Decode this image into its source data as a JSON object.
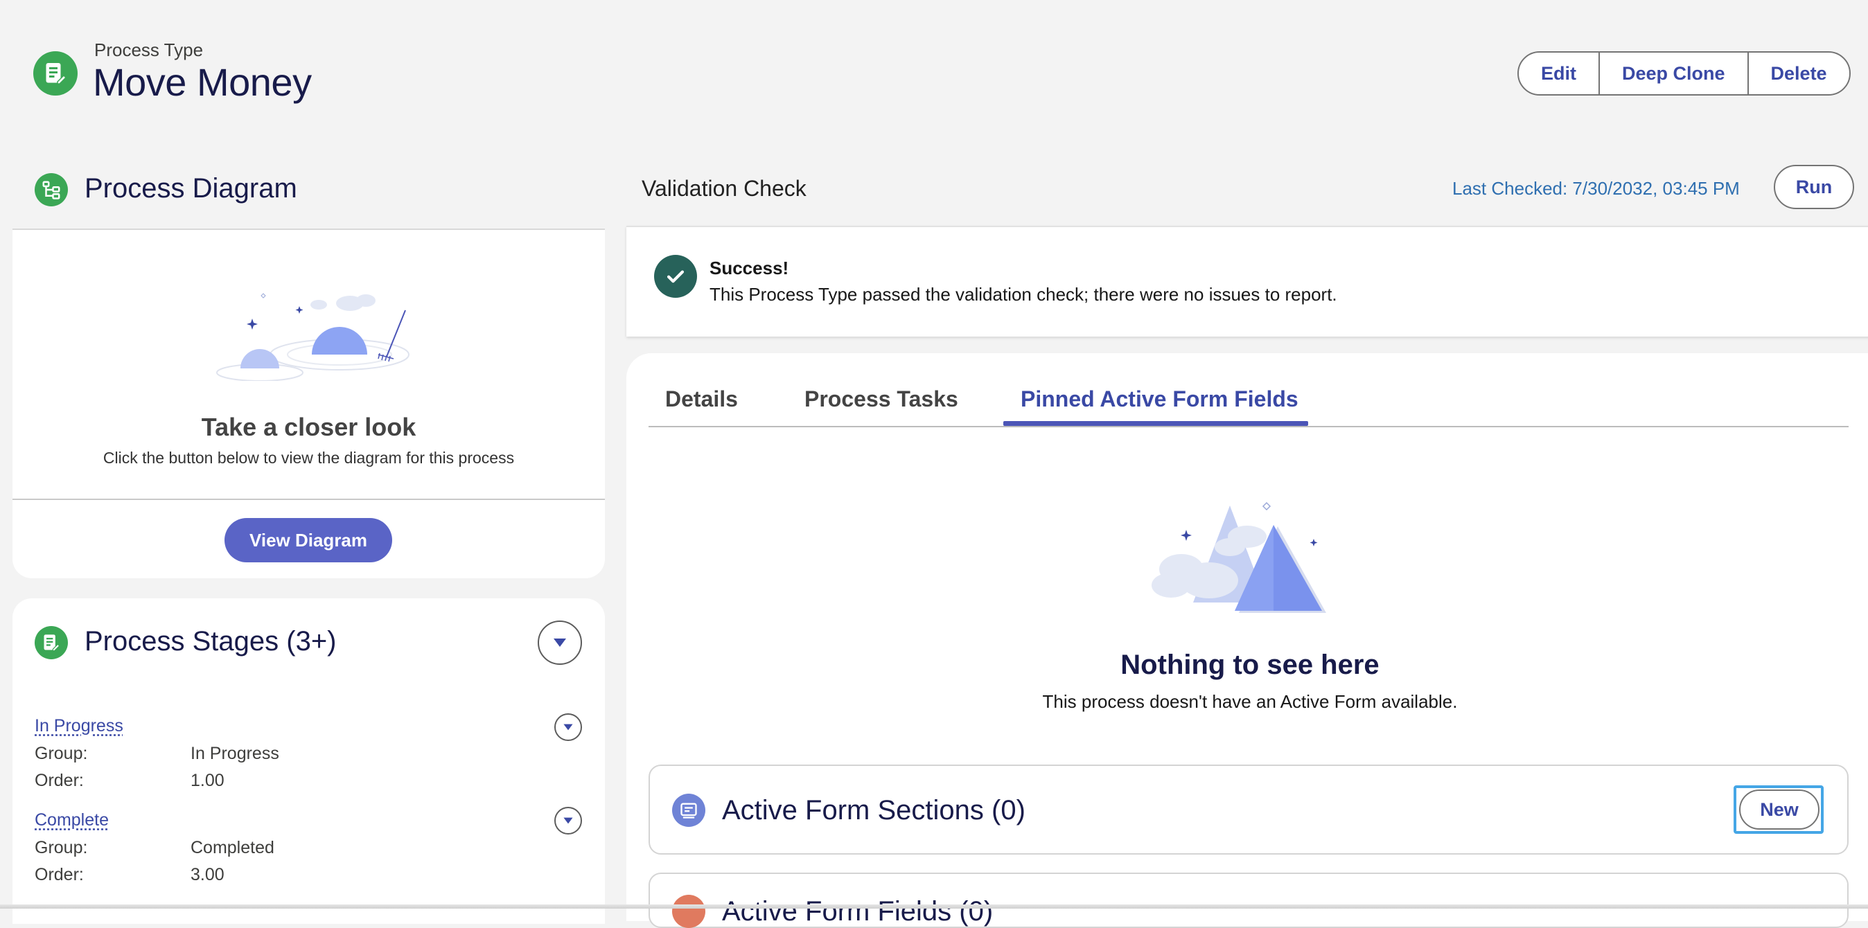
{
  "header": {
    "eyebrow": "Process Type",
    "title": "Move Money",
    "actions": [
      "Edit",
      "Deep Clone",
      "Delete"
    ],
    "icon": "form-edit-icon"
  },
  "process_diagram": {
    "title": "Process Diagram",
    "icon": "hierarchy-icon",
    "empty_title": "Take a closer look",
    "empty_message": "Click the button below to view the diagram for this process",
    "button_label": "View Diagram"
  },
  "process_stages": {
    "title": "Process Stages (3+)",
    "icon": "form-edit-icon",
    "group_label": "Group:",
    "order_label": "Order:",
    "items": [
      {
        "name": "In Progress",
        "group": "In Progress",
        "order": "1.00"
      },
      {
        "name": "Complete",
        "group": "Completed",
        "order": "3.00"
      }
    ]
  },
  "validation": {
    "title": "Validation Check",
    "last_checked": "Last Checked: 7/30/2032, 03:45 PM",
    "run_label": "Run",
    "status_title": "Success!",
    "status_message": "This Process Type passed the validation check; there were no issues to report."
  },
  "tabs": {
    "items": [
      "Details",
      "Process Tasks",
      "Pinned Active Form Fields"
    ],
    "active_index": 2
  },
  "pinned_fields": {
    "empty_title": "Nothing to see here",
    "empty_message": "This process doesn't have an Active Form available."
  },
  "active_form_sections": {
    "title": "Active Form Sections (0)",
    "new_label": "New"
  },
  "active_form_fields": {
    "title": "Active Form Fields (0)"
  },
  "colors": {
    "accent": "#3a49a5",
    "primary_button": "#5a64c6",
    "success": "#27625a",
    "green_icon": "#3ba755"
  }
}
